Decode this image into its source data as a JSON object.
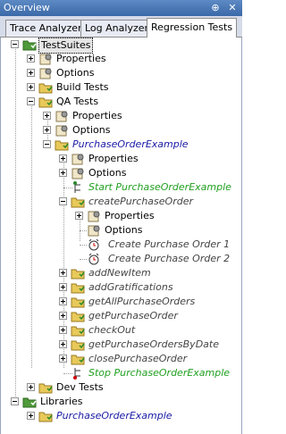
{
  "window": {
    "title": "Overview"
  },
  "tabs": [
    {
      "label": "Trace Analyzer"
    },
    {
      "label": "Log Analyzer"
    },
    {
      "label": "Regression Tests"
    }
  ],
  "tree": {
    "root": "TestSuites",
    "properties": "Properties",
    "options": "Options",
    "build_tests": "Build Tests",
    "qa_tests": "QA Tests",
    "qa_properties": "Properties",
    "qa_options": "Options",
    "suite": "PurchaseOrderExample",
    "suite_properties": "Properties",
    "suite_options": "Options",
    "start": "Start PurchaseOrderExample",
    "create": "createPurchaseOrder",
    "create_properties": "Properties",
    "create_options": "Options",
    "create_po_1": "Create Purchase Order 1",
    "create_po_2": "Create Purchase Order 2",
    "add_new_item": "addNewItem",
    "add_gratifications": "addGratifications",
    "get_all": "getAllPurchaseOrders",
    "get_po": "getPurchaseOrder",
    "checkout": "checkOut",
    "get_by_date": "getPurchaseOrdersByDate",
    "close_po": "closePurchaseOrder",
    "stop": "Stop PurchaseOrderExample",
    "dev_tests": "Dev Tests",
    "libraries": "Libraries",
    "lib_suite": "PurchaseOrderExample"
  }
}
